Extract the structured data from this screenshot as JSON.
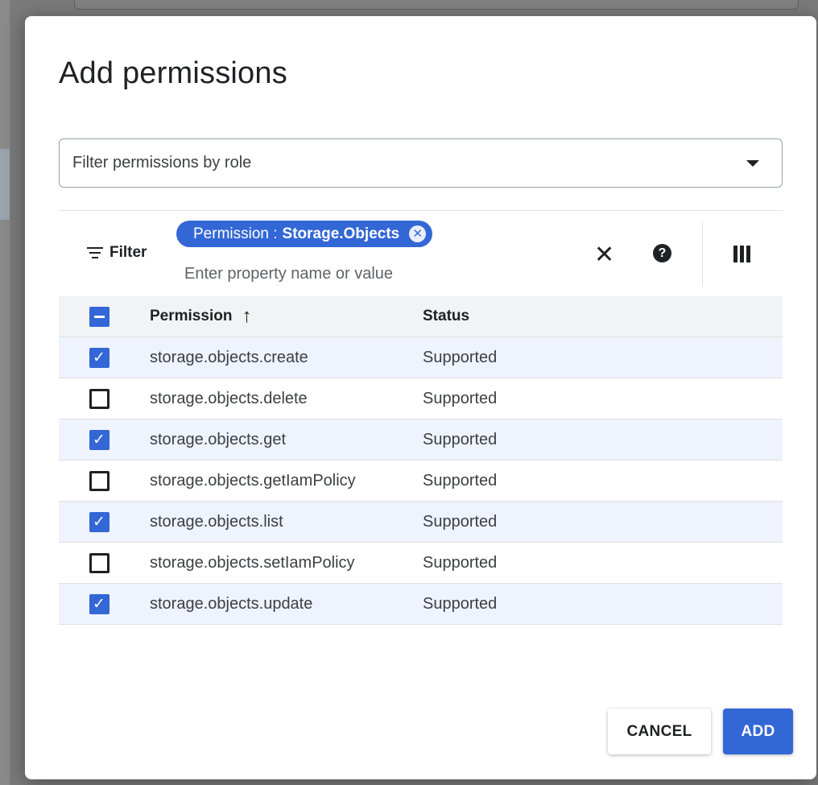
{
  "dialog": {
    "title": "Add permissions",
    "role_select": {
      "placeholder": "Filter permissions by role"
    },
    "filter": {
      "label": "Filter",
      "chip": {
        "key": "Permission : ",
        "value": "Storage.Objects"
      },
      "input_placeholder": "Enter property name or value"
    },
    "table": {
      "columns": {
        "permission": "Permission",
        "status": "Status"
      },
      "sort": "ascending",
      "header_checkbox": "partial",
      "rows": [
        {
          "permission": "storage.objects.create",
          "status": "Supported",
          "checked": true
        },
        {
          "permission": "storage.objects.delete",
          "status": "Supported",
          "checked": false
        },
        {
          "permission": "storage.objects.get",
          "status": "Supported",
          "checked": true
        },
        {
          "permission": "storage.objects.getIamPolicy",
          "status": "Supported",
          "checked": false
        },
        {
          "permission": "storage.objects.list",
          "status": "Supported",
          "checked": true
        },
        {
          "permission": "storage.objects.setIamPolicy",
          "status": "Supported",
          "checked": false
        },
        {
          "permission": "storage.objects.update",
          "status": "Supported",
          "checked": true
        }
      ]
    },
    "actions": {
      "cancel": "CANCEL",
      "add": "ADD"
    }
  },
  "colors": {
    "accent": "#3367d6",
    "selected_row": "#eef3fd",
    "header_row": "#f1f3f4"
  },
  "icons": [
    "filter-icon",
    "chip-close-icon",
    "clear-icon",
    "help-icon",
    "columns-icon",
    "sort-arrow-icon",
    "dropdown-caret-icon"
  ]
}
